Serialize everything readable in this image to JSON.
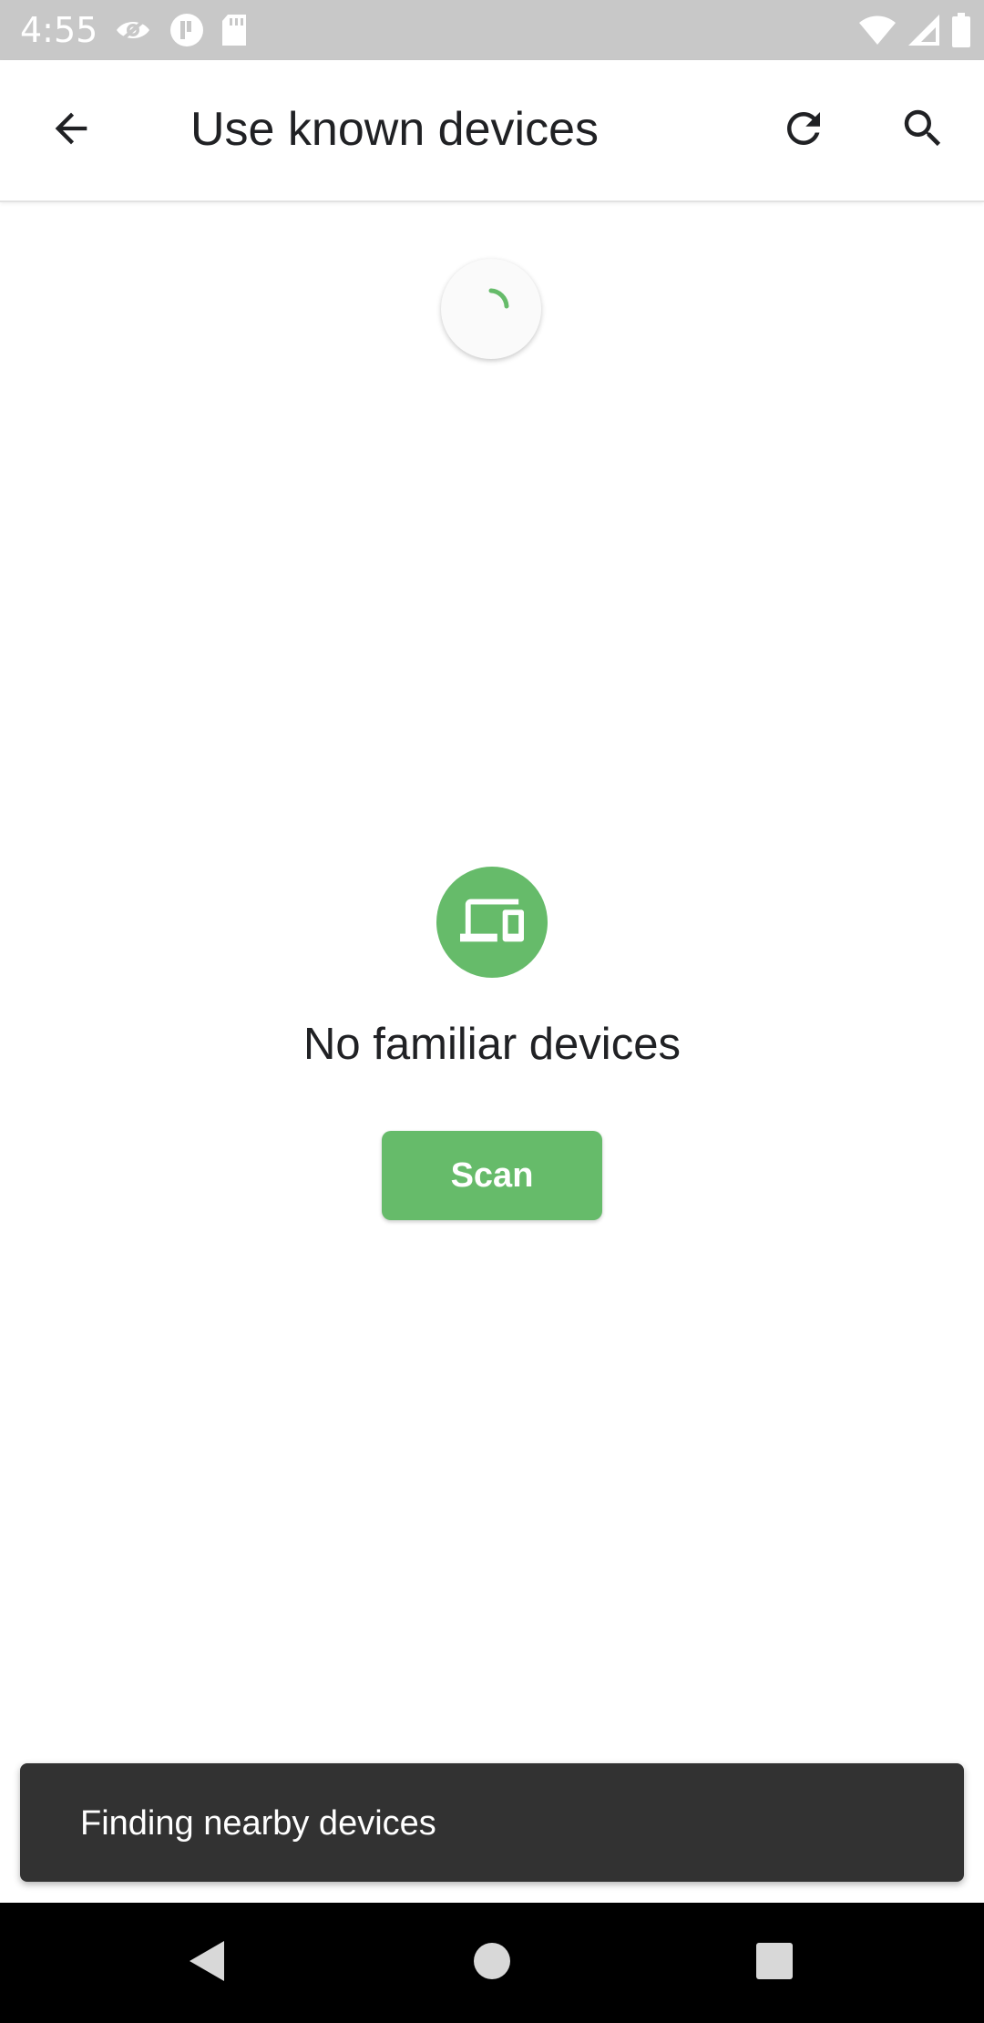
{
  "status_bar": {
    "time": "4:55",
    "left_icons": [
      "eye-slash-icon",
      "t-circle-icon",
      "sd-card-icon"
    ],
    "right_icons": [
      "wifi-icon",
      "cell-signal-icon",
      "battery-icon"
    ]
  },
  "app_bar": {
    "title": "Use known devices",
    "back_icon": "arrow-back-icon",
    "refresh_icon": "refresh-icon",
    "search_icon": "search-icon"
  },
  "loader": {
    "icon": "progress-spinner-icon"
  },
  "empty_state": {
    "icon": "devices-icon",
    "message": "No familiar devices",
    "button_label": "Scan"
  },
  "snackbar": {
    "message": "Finding nearby devices"
  },
  "nav_bar": {
    "icons": [
      "nav-back-icon",
      "nav-home-icon",
      "nav-recents-icon"
    ]
  },
  "colors": {
    "accent": "#66bb6a",
    "text_primary": "#202124",
    "status_bar": "#c8c8c8",
    "snackbar": "#323232"
  }
}
